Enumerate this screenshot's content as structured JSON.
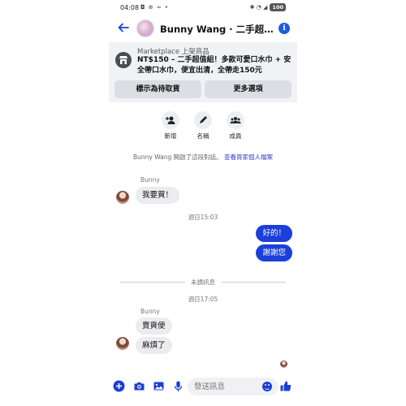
{
  "status_bar": {
    "time": "04:08",
    "left_icons": "◘ ⊕ ∞ •",
    "right_icons": "✱ ◔ ◢",
    "battery": "100"
  },
  "header": {
    "title": "Bunny Wang · 二手超…",
    "info_glyph": "i"
  },
  "marketplace": {
    "label": "Marketplace 上架商品",
    "description": "NT$150 – 二手超值組！多款可愛口水巾 + 安全帶口水巾，便宜出清，全帶走150元",
    "mark_pending_button": "標示為待取貨",
    "more_options_button": "更多選項"
  },
  "actions": [
    {
      "label": "新增",
      "icon": "add-person-icon"
    },
    {
      "label": "名稱",
      "icon": "pencil-icon"
    },
    {
      "label": "成員",
      "icon": "group-icon"
    }
  ],
  "system_message": {
    "text": "Bunny Wang 開啟了這段對話。",
    "link": "查看買家個人檔案"
  },
  "conversation": {
    "sender_1": "Bunny",
    "msg_1": "我要買！",
    "time_1": "週日15:03",
    "out_1": "好的！",
    "out_2": "謝謝您",
    "unread_divider": "未讀訊息",
    "time_2": "週日17:05",
    "sender_2": "Bunny",
    "msg_2": "賣貨便",
    "msg_3": "麻煩了"
  },
  "composer": {
    "placeholder": "發送訊息"
  },
  "colors": {
    "accent": "#1b3fd8",
    "link": "#3a3ad0",
    "incoming_bubble": "#ececef",
    "card_bg": "#f1f2f5"
  }
}
